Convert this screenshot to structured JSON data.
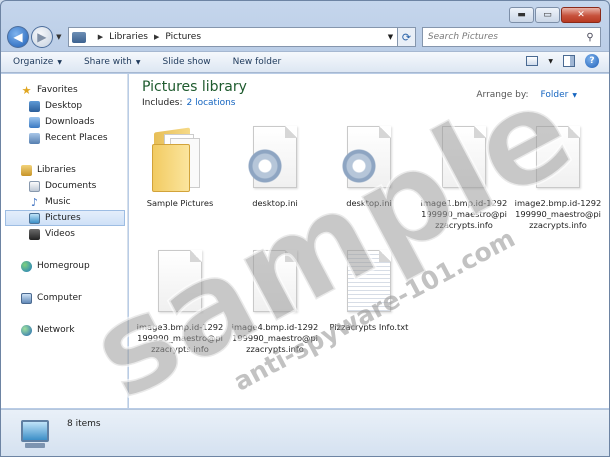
{
  "window": {
    "caption_minimize": "▬",
    "caption_maximize": "▭",
    "caption_close": "✕"
  },
  "address": {
    "crumbs": [
      "Libraries",
      "Pictures"
    ],
    "search_placeholder": "Search Pictures"
  },
  "toolbar": {
    "organize": "Organize",
    "share_with": "Share with",
    "slide_show": "Slide show",
    "new_folder": "New folder"
  },
  "nav": {
    "favorites": "Favorites",
    "desktop": "Desktop",
    "downloads": "Downloads",
    "recent_places": "Recent Places",
    "libraries": "Libraries",
    "documents": "Documents",
    "music": "Music",
    "pictures": "Pictures",
    "videos": "Videos",
    "homegroup": "Homegroup",
    "computer": "Computer",
    "network": "Network"
  },
  "library": {
    "title": "Pictures library",
    "includes_label": "Includes:",
    "includes_link": "2 locations",
    "arrange_label": "Arrange by:",
    "arrange_value": "Folder"
  },
  "files": [
    {
      "name": "Sample Pictures",
      "kind": "folder"
    },
    {
      "name": "desktop.ini",
      "kind": "settings"
    },
    {
      "name": "desktop.ini",
      "kind": "settings"
    },
    {
      "name": "image1.bmp.id-1292199990_maestro@pizzacrypts.info",
      "kind": "file"
    },
    {
      "name": "image2.bmp.id-1292199990_maestro@pizzacrypts.info",
      "kind": "file"
    },
    {
      "name": "image3.bmp.id-1292199990_maestro@pizzacrypts.info",
      "kind": "file"
    },
    {
      "name": "image4.bmp.id-1292199990_maestro@pizzacrypts.info",
      "kind": "file"
    },
    {
      "name": "Pizzacrypts Info.txt",
      "kind": "text"
    }
  ],
  "status": {
    "count": "8 items"
  },
  "watermark": {
    "main": "sample",
    "sub": "anti-spyware-101.com"
  }
}
